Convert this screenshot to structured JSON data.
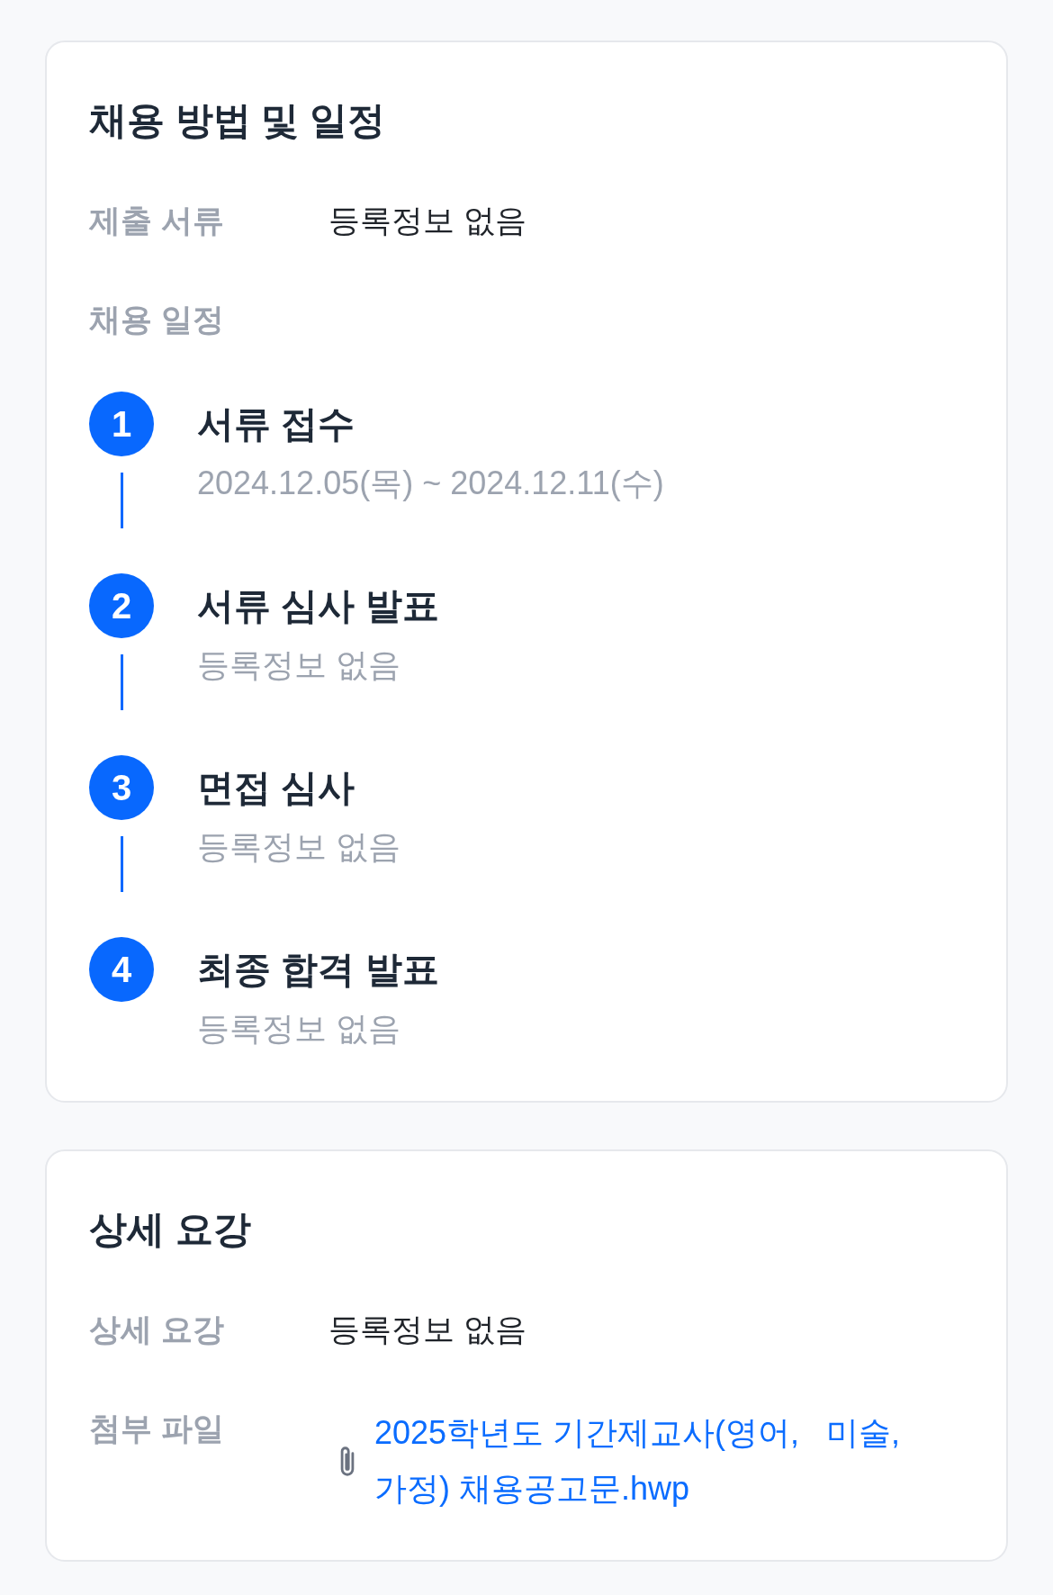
{
  "sections": [
    {
      "title": "채용 방법 및 일정",
      "fields": [
        {
          "kind": "text",
          "label": "제출 서류",
          "value": "등록정보 없음"
        }
      ],
      "schedule": {
        "label": "채용 일정",
        "steps": [
          {
            "number": "1",
            "title": "서류 접수",
            "detail": "2024.12.05(목) ~ 2024.12.11(수)"
          },
          {
            "number": "2",
            "title": "서류 심사 발표",
            "detail": "등록정보 없음"
          },
          {
            "number": "3",
            "title": "면접 심사",
            "detail": "등록정보 없음"
          },
          {
            "number": "4",
            "title": "최종 합격 발표",
            "detail": "등록정보 없음"
          }
        ]
      }
    },
    {
      "title": "상세 요강",
      "fields": [
        {
          "kind": "text",
          "label": "상세 요강",
          "value": "등록정보 없음"
        },
        {
          "kind": "attachment",
          "label": "첨부 파일",
          "value": "2025학년도 기간제교사(영어,   미술, 가정) 채용공고문.hwp"
        }
      ]
    }
  ]
}
